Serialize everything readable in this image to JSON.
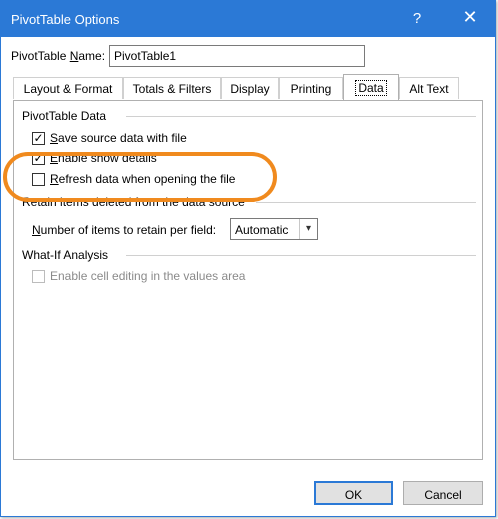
{
  "window": {
    "title": "PivotTable Options",
    "help_symbol": "?",
    "close_symbol": "✕",
    "accent_color": "#2b79d6"
  },
  "name_field": {
    "label_prefix": "PivotTable ",
    "label_key": "N",
    "label_suffix": "ame:",
    "value": "PivotTable1"
  },
  "tabs": [
    {
      "label": "Layout & Format",
      "active": false
    },
    {
      "label": "Totals & Filters",
      "active": false
    },
    {
      "label": "Display",
      "active": false
    },
    {
      "label": "Printing",
      "active": false
    },
    {
      "label": "Data",
      "active": true
    },
    {
      "label": "Alt Text",
      "active": false
    }
  ],
  "data_tab": {
    "pivot_group_title": "PivotTable Data",
    "save_source": {
      "key": "S",
      "rest": "ave source data with file",
      "checked": true
    },
    "enable_details": {
      "key": "E",
      "rest": "nable show details",
      "checked": true
    },
    "refresh_on_open": {
      "key": "R",
      "rest": "efresh data when opening the file",
      "checked": false
    },
    "retain_group_title": "Retain items deleted from the data source",
    "retain_label_key": "N",
    "retain_label_rest": "umber of items to retain per field:",
    "retain_select_value": "Automatic",
    "whatif_group_title": "What-If Analysis",
    "enable_cell_editing": {
      "label": "Enable cell editing in the values area",
      "checked": false,
      "disabled": true
    },
    "highlight_color": "#f08a1e"
  },
  "buttons": {
    "ok": "OK",
    "cancel": "Cancel"
  },
  "icons": {
    "check": "✓",
    "dropdown": "▾"
  }
}
